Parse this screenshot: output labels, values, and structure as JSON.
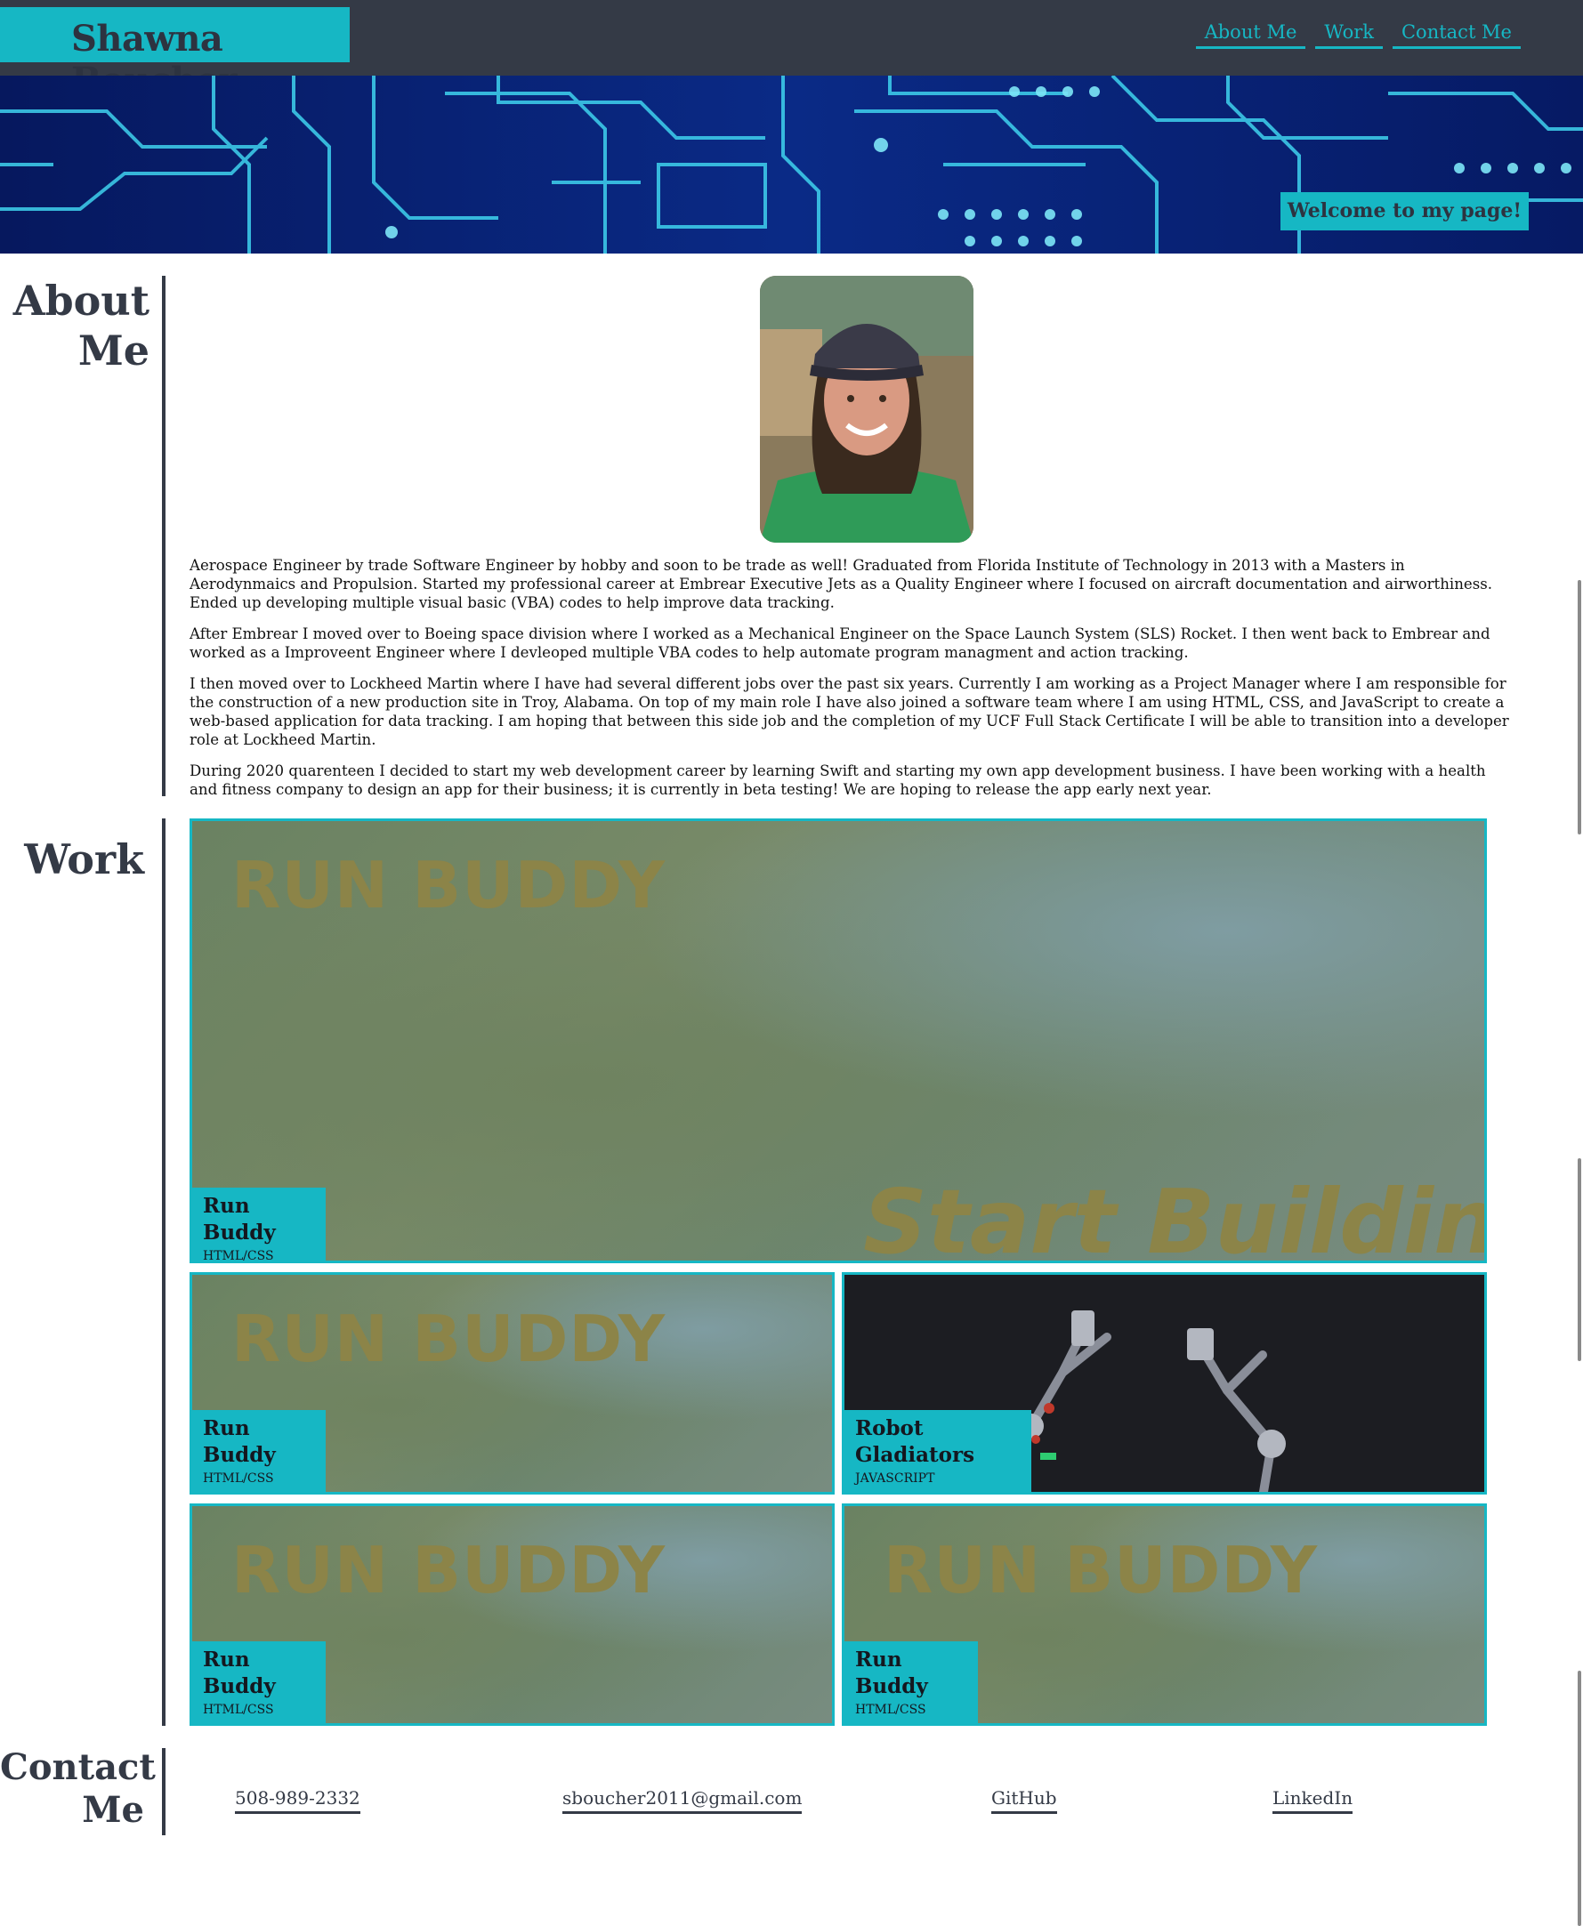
{
  "header": {
    "brand": "Shawna Boucher",
    "nav": [
      {
        "label": "About Me"
      },
      {
        "label": "Work"
      },
      {
        "label": "Contact Me"
      }
    ]
  },
  "hero": {
    "welcome": "Welcome to my page!"
  },
  "about": {
    "title_line1": "About",
    "title_line2": "Me",
    "paragraphs": [
      "Aerospace Engineer by trade Software Engineer by hobby and soon to be trade as well! Graduated from Florida Institute of Technology in 2013 with a Masters in Aerodynmaics and Propulsion. Started my professional career at Embrear Executive Jets as a Quality Engineer where I focused on aircraft documentation and airworthiness. Ended up developing multiple visual basic (VBA) codes to help improve data tracking.",
      "After Embrear I moved over to Boeing space division where I worked as a Mechanical Engineer on the Space Launch System (SLS) Rocket. I then went back to Embrear and worked as a Improveent Engineer where I devleoped multiple VBA codes to help automate program managment and action tracking.",
      "I then moved over to Lockheed Martin where I have had several different jobs over the past six years. Currently I am working as a Project Manager where I am responsible for the construction of a new production site in Troy, Alabama. On top of my main role I have also joined a software team where I am using HTML, CSS, and JavaScript to create a web-based application for data tracking. I am hoping that between this side job and the completion of my UCF Full Stack Certificate I will be able to transition into a developer role at Lockheed Martin.",
      "During 2020 quarenteen I decided to start my web development career by learning Swift and starting my own app development business. I have been working with a health and fitness company to design an app for their business; it is currently in beta testing! We are hoping to release the app early next year."
    ]
  },
  "work": {
    "title": "Work",
    "projects": [
      {
        "name": "Run Buddy",
        "tech": "HTML/CSS",
        "image_text": "RUN BUDDY",
        "image_subtext": "Start Building"
      },
      {
        "name": "Run Buddy",
        "tech": "HTML/CSS",
        "image_text": "RUN BUDDY"
      },
      {
        "name": "Robot Gladiators",
        "tech": "JAVASCRIPT"
      },
      {
        "name": "Run Buddy",
        "tech": "HTML/CSS",
        "image_text": "RUN BUDDY"
      },
      {
        "name": "Run Buddy",
        "tech": "HTML/CSS",
        "image_text": "RUN BUDDY"
      }
    ]
  },
  "contact": {
    "title_line1": "Contact",
    "title_line2": "Me",
    "links": [
      {
        "label": "508-989-2332"
      },
      {
        "label": "sboucher2011@gmail.com"
      },
      {
        "label": "GitHub"
      },
      {
        "label": "LinkedIn"
      }
    ]
  },
  "colors": {
    "accent": "#16b7c4",
    "dark": "#343a46",
    "hero_bg": "#04145a"
  }
}
